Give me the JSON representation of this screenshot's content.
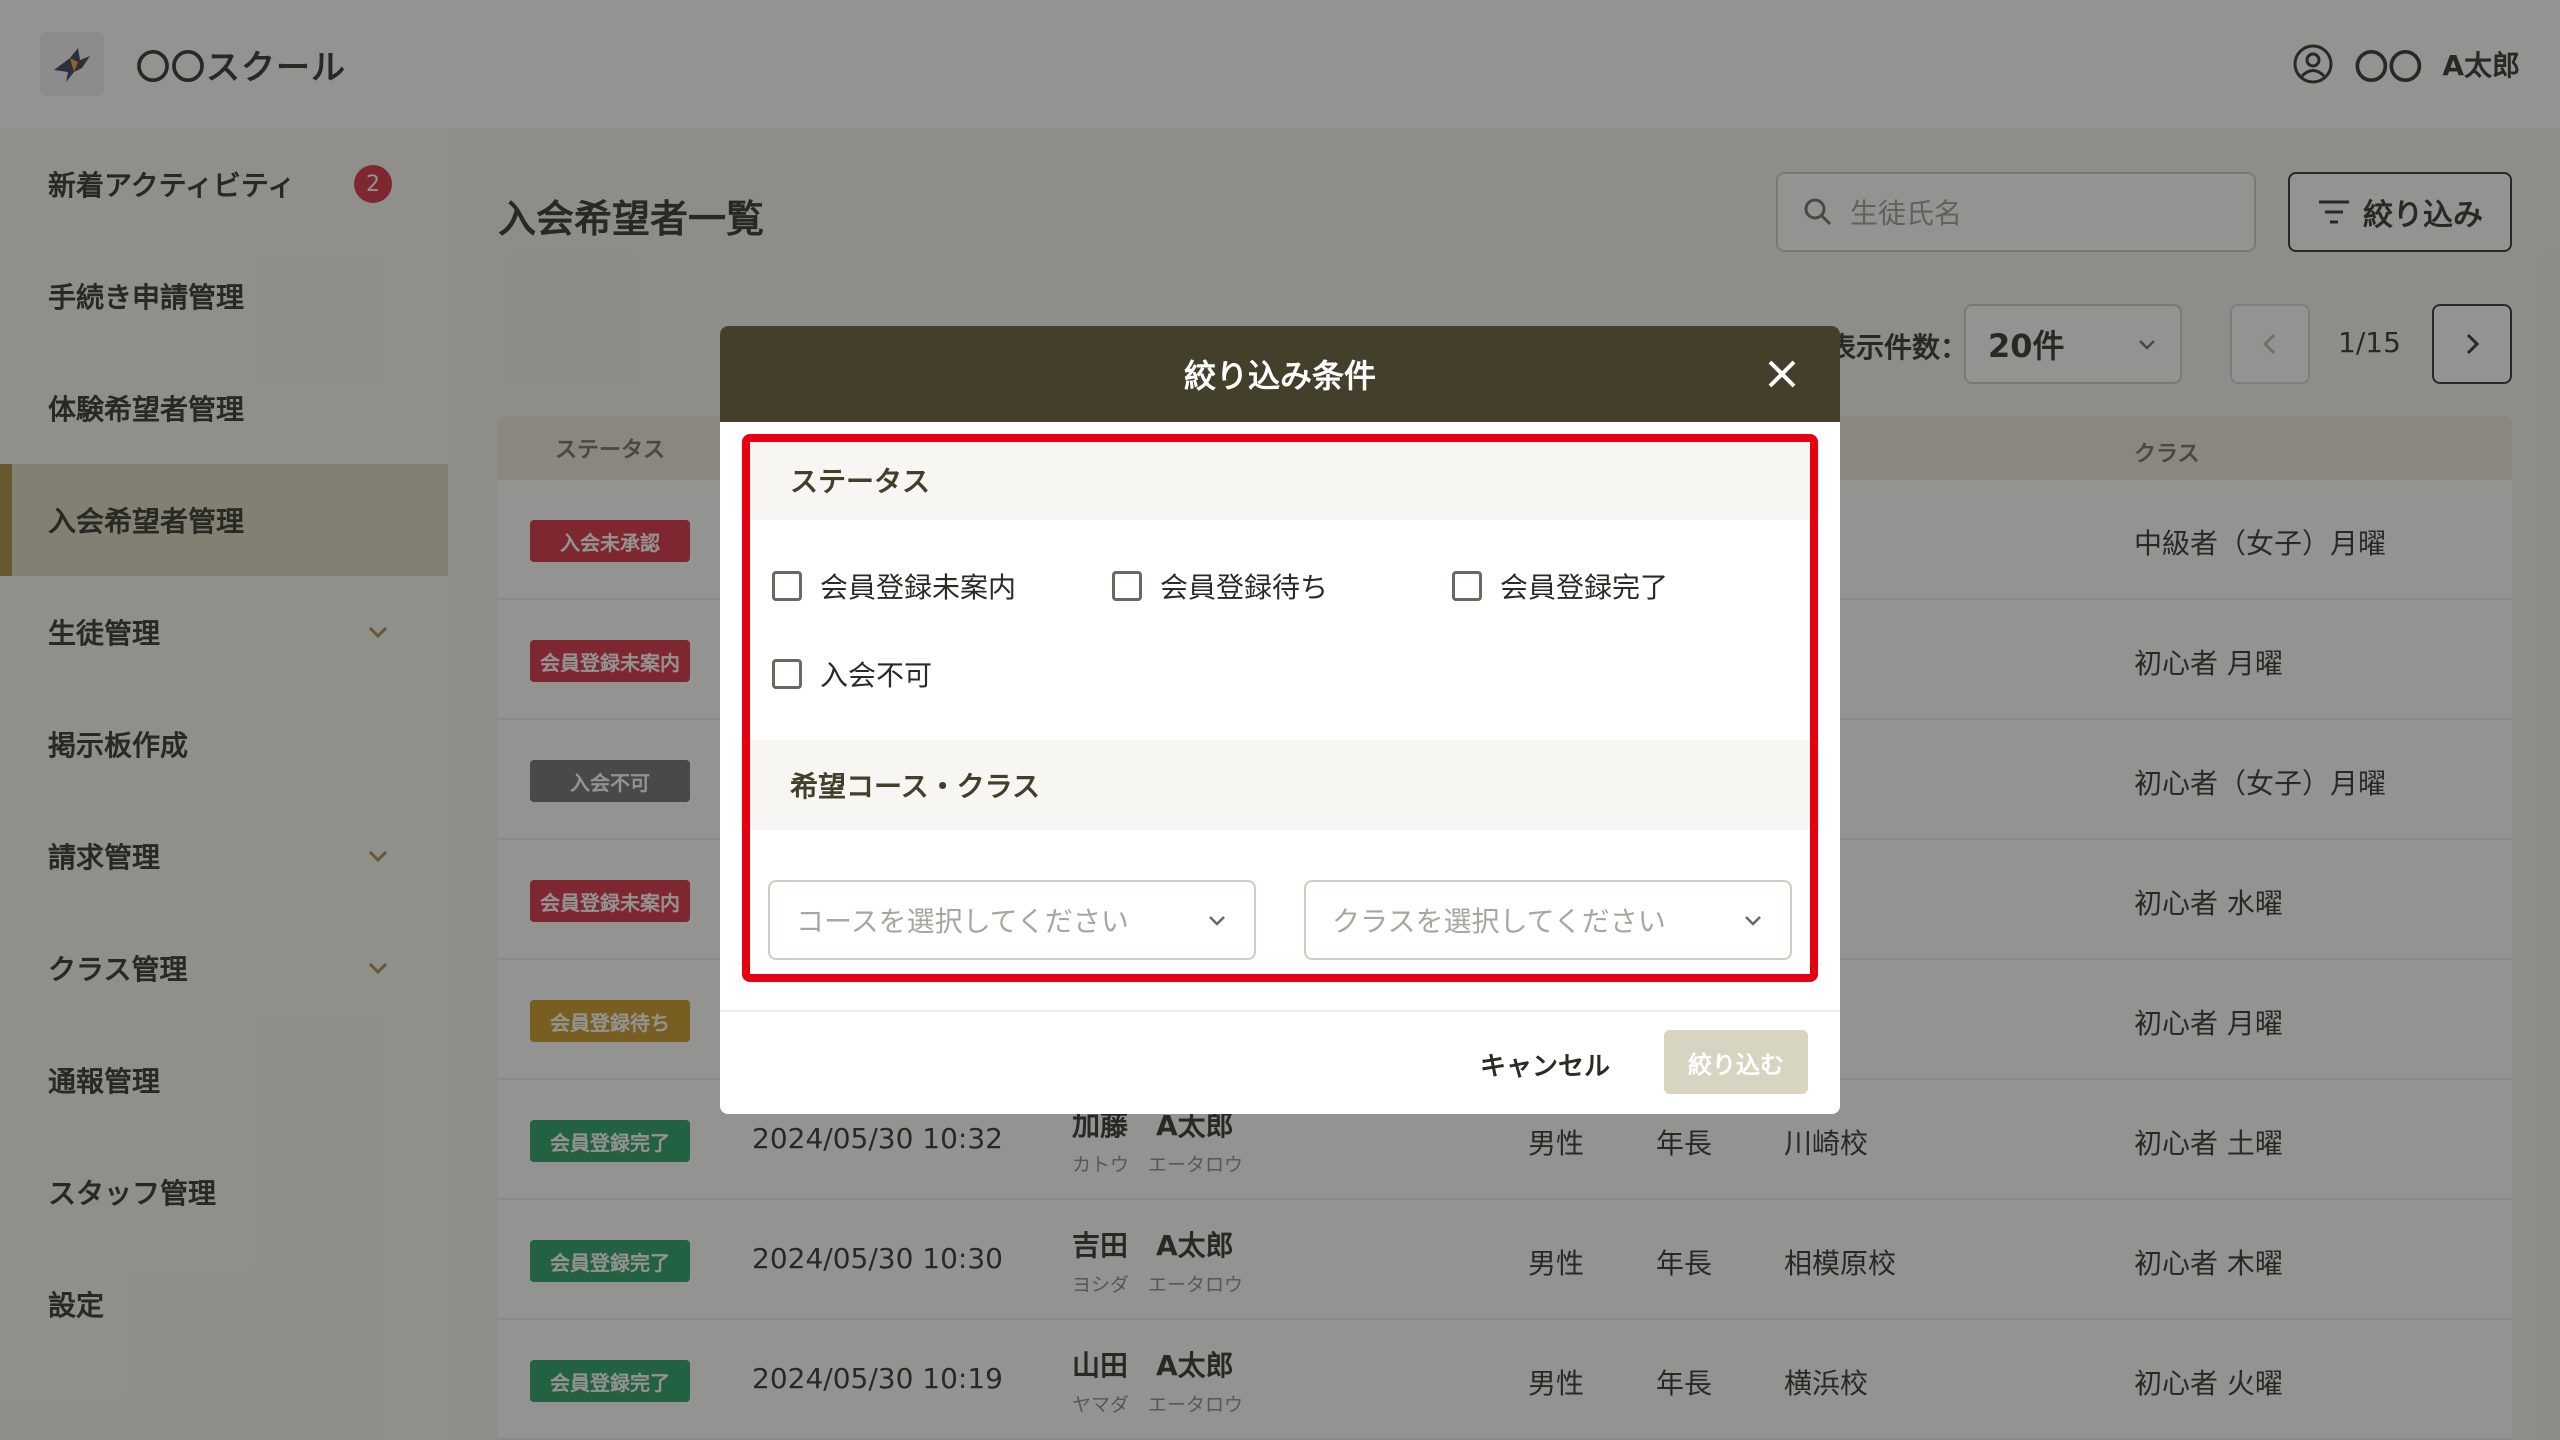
{
  "header": {
    "app_name": "〇〇スクール",
    "user_org": "〇〇",
    "user_name": "A太郎"
  },
  "sidebar": {
    "items": [
      {
        "label": "新着アクティビティ",
        "badge": "2"
      },
      {
        "label": "手続き申請管理"
      },
      {
        "label": "体験希望者管理"
      },
      {
        "label": "入会希望者管理",
        "active": true
      },
      {
        "label": "生徒管理",
        "chevron": true
      },
      {
        "label": "掲示板作成"
      },
      {
        "label": "請求管理",
        "chevron": true
      },
      {
        "label": "クラス管理",
        "chevron": true
      },
      {
        "label": "通報管理"
      },
      {
        "label": "スタッフ管理"
      },
      {
        "label": "設定"
      }
    ]
  },
  "main": {
    "title": "入会希望者一覧",
    "search_placeholder": "生徒氏名",
    "filter_label": "絞り込み",
    "perpage_label": "表示件数：",
    "perpage_value": "20件",
    "page_text": "1/15"
  },
  "table": {
    "headers": {
      "status": "ステータス",
      "class": "クラス"
    },
    "rows": [
      {
        "status": "入会未承認",
        "status_color": "#d7263d",
        "date": "",
        "name": "",
        "kana": "",
        "gender": "",
        "grade": "",
        "school": "",
        "class": "中級者（女子）月曜"
      },
      {
        "status": "会員登録未案内",
        "status_color": "#d7263d",
        "date": "",
        "name": "",
        "kana": "",
        "gender": "",
        "grade": "",
        "school": "",
        "class": "初心者 月曜"
      },
      {
        "status": "入会不可",
        "status_color": "#6b6b6b",
        "date": "",
        "name": "",
        "kana": "",
        "gender": "",
        "grade": "",
        "school": "",
        "class": "初心者（女子）月曜"
      },
      {
        "status": "会員登録未案内",
        "status_color": "#d7263d",
        "date": "",
        "name": "",
        "kana": "",
        "gender": "",
        "grade": "",
        "school": "",
        "class": "初心者 水曜"
      },
      {
        "status": "会員登録待ち",
        "status_color": "#c8961e",
        "date": "",
        "name": "",
        "kana": "",
        "gender": "",
        "grade": "",
        "school": "",
        "class": "初心者 月曜"
      },
      {
        "status": "会員登録完了",
        "status_color": "#1f9a63",
        "date": "2024/05/30 10:32",
        "name": "加藤　A太郎",
        "kana": "カトウ　エータロウ",
        "gender": "男性",
        "grade": "年長",
        "school": "川崎校",
        "class": "初心者 土曜"
      },
      {
        "status": "会員登録完了",
        "status_color": "#1f9a63",
        "date": "2024/05/30 10:30",
        "name": "吉田　A太郎",
        "kana": "ヨシダ　エータロウ",
        "gender": "男性",
        "grade": "年長",
        "school": "相模原校",
        "class": "初心者 木曜"
      },
      {
        "status": "会員登録完了",
        "status_color": "#1f9a63",
        "date": "2024/05/30 10:19",
        "name": "山田　A太郎",
        "kana": "ヤマダ　エータロウ",
        "gender": "男性",
        "grade": "年長",
        "school": "横浜校",
        "class": "初心者 火曜"
      }
    ]
  },
  "modal": {
    "title": "絞り込み条件",
    "status_section": "ステータス",
    "status_options": [
      "会員登録未案内",
      "会員登録待ち",
      "会員登録完了",
      "入会不可"
    ],
    "course_section": "希望コース・クラス",
    "course_placeholder": "コースを選択してください",
    "class_placeholder": "クラスを選択してください",
    "cancel_label": "キャンセル",
    "apply_label": "絞り込む"
  },
  "colors": {
    "header_dark": "#433f2a",
    "accent": "#a58a3a",
    "highlight": "#e60012"
  }
}
